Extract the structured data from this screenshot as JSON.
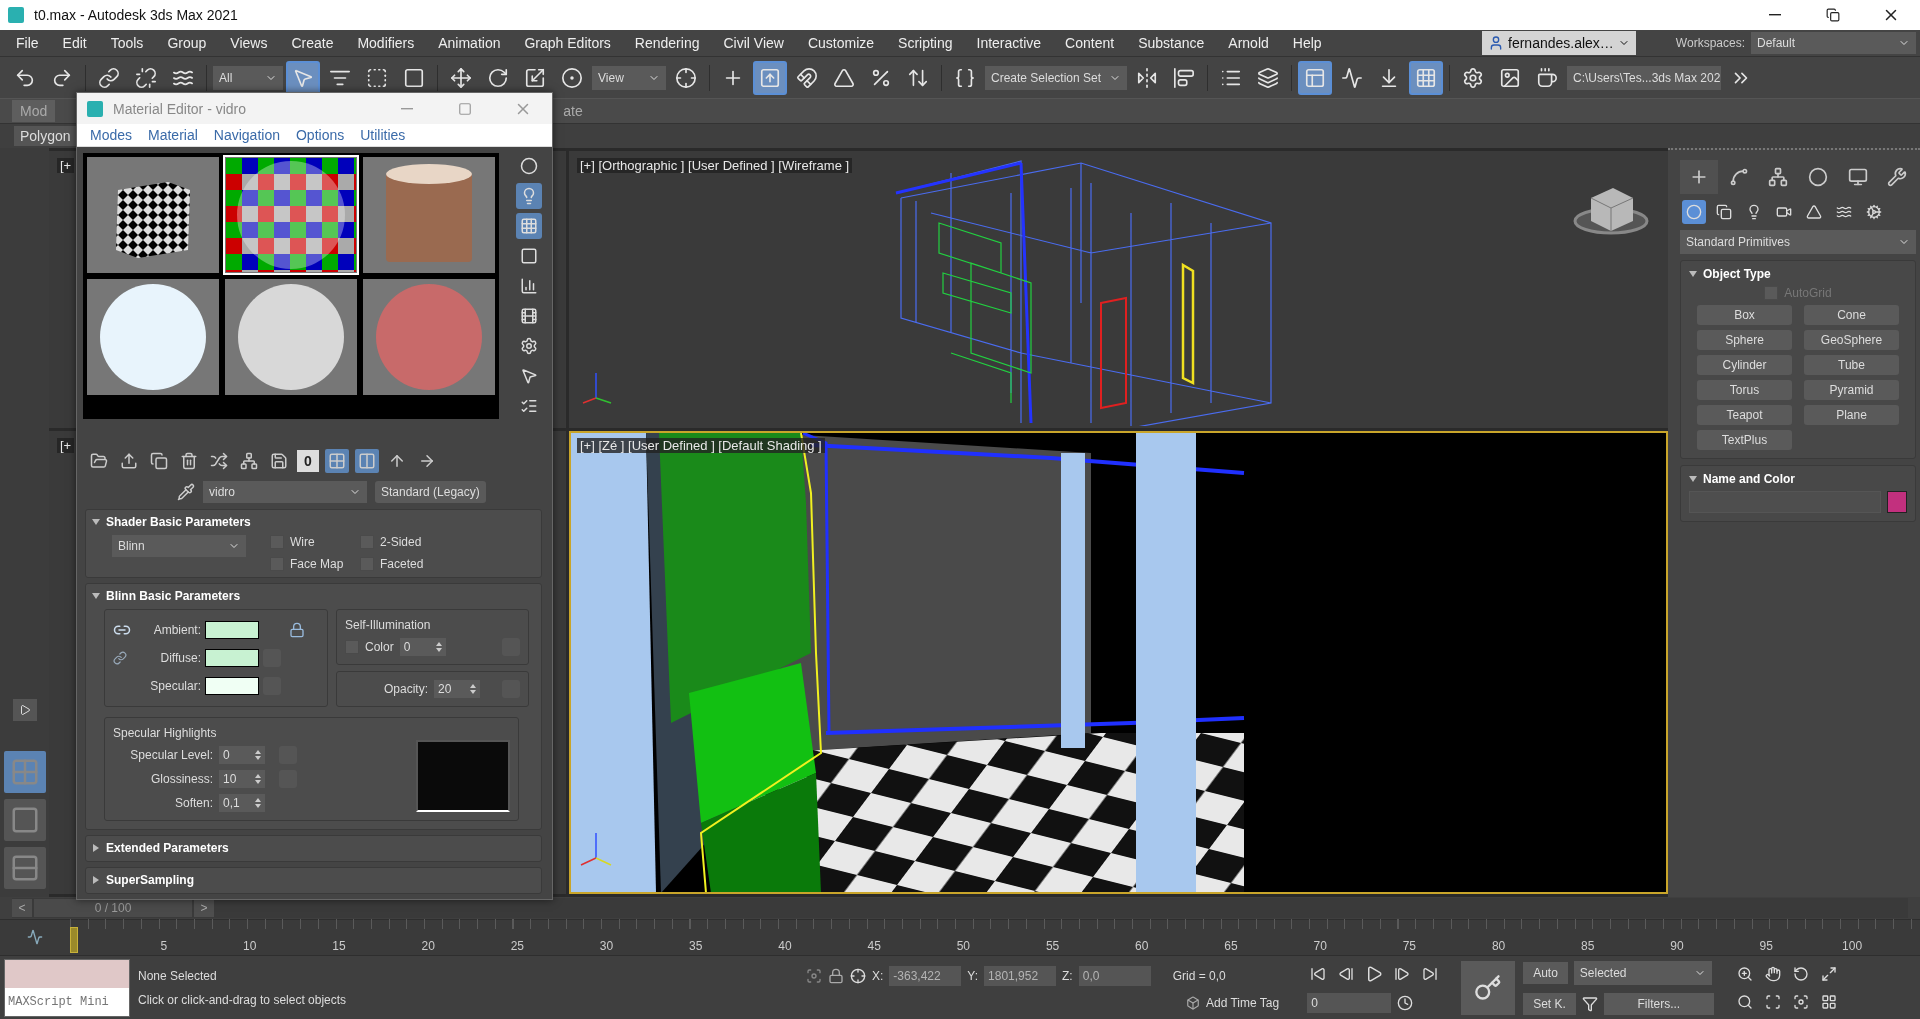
{
  "window": {
    "title": "t0.max - Autodesk 3ds Max 2021"
  },
  "menu": [
    "File",
    "Edit",
    "Tools",
    "Group",
    "Views",
    "Create",
    "Modifiers",
    "Animation",
    "Graph Editors",
    "Rendering",
    "Civil View",
    "Customize",
    "Scripting",
    "Interactive",
    "Content",
    "Substance",
    "Arnold",
    "Help"
  ],
  "account": {
    "name": "fernandes.alex…"
  },
  "workspaces": {
    "label": "Workspaces:",
    "value": "Default"
  },
  "toolbar": [
    {
      "kind": "tool",
      "selected": false
    },
    {
      "kind": "tool",
      "selected": false
    },
    {
      "kind": "tool",
      "selected": false
    },
    {
      "kind": "tool",
      "selected": false
    },
    {
      "kind": "tool",
      "selected": false
    },
    {
      "kind": "dropdown",
      "value": "All"
    },
    {
      "kind": "tool",
      "selected": true
    },
    {
      "kind": "tool",
      "selected": false
    },
    {
      "kind": "tool",
      "selected": false
    },
    {
      "kind": "tool",
      "selected": false
    },
    {
      "kind": "tool",
      "selected": false
    },
    {
      "kind": "tool",
      "selected": false
    },
    {
      "kind": "tool",
      "selected": false
    },
    {
      "kind": "tool",
      "selected": false
    },
    {
      "kind": "dropdown",
      "value": "View"
    },
    {
      "kind": "tool",
      "selected": false
    },
    {
      "kind": "tool",
      "selected": false
    },
    {
      "kind": "tool",
      "selected": true
    },
    {
      "kind": "tool",
      "selected": false
    },
    {
      "kind": "tool",
      "selected": false
    },
    {
      "kind": "tool",
      "selected": false
    },
    {
      "kind": "tool",
      "selected": false
    },
    {
      "kind": "tool",
      "selected": false
    },
    {
      "kind": "dropdown",
      "value": "Create Selection Set"
    },
    {
      "kind": "tool",
      "selected": false
    },
    {
      "kind": "tool",
      "selected": false
    },
    {
      "kind": "tool",
      "selected": false
    },
    {
      "kind": "tool",
      "selected": false
    },
    {
      "kind": "tool",
      "selected": true
    },
    {
      "kind": "tool",
      "selected": false
    },
    {
      "kind": "tool",
      "selected": false
    },
    {
      "kind": "tool",
      "selected": true
    },
    {
      "kind": "tool",
      "selected": false
    },
    {
      "kind": "tool",
      "selected": false
    },
    {
      "kind": "tool",
      "selected": false
    },
    {
      "kind": "dropdown",
      "value": "C:\\Users\\Tes...3ds Max 202"
    },
    {
      "kind": "tool",
      "selected": false
    }
  ],
  "ribbon": {
    "tabs": [
      {
        "label": "Mod",
        "selected": true
      },
      {
        "label": "ate",
        "selected": false
      }
    ],
    "panel": "Polygon"
  },
  "layout_tabs": [
    {
      "selected": true
    },
    {
      "selected": false
    },
    {
      "selected": false
    }
  ],
  "viewports": [
    {
      "label": "[+",
      "kind": "hidden",
      "active": false
    },
    {
      "label": "[+] [Orthographic ] [User Defined ] [Wireframe ]",
      "kind": "wireframe",
      "active": false
    },
    {
      "label": "[+",
      "kind": "hidden",
      "active": false
    },
    {
      "label": "[+] [Zé ] [User Defined ] [Default Shading ]",
      "kind": "shaded",
      "active": true
    }
  ],
  "material_editor": {
    "title": "Material Editor - vidro",
    "menu": [
      "Modes",
      "Material",
      "Navigation",
      "Options",
      "Utilities"
    ],
    "slots": [
      {
        "kind": "cube",
        "selected": false
      },
      {
        "kind": "checker",
        "selected": true
      },
      {
        "kind": "photo",
        "selected": false
      },
      {
        "kind": "sphere",
        "selected": false,
        "color": "#e8f4fc"
      },
      {
        "kind": "sphere",
        "selected": false,
        "color": "#d8d8d8"
      },
      {
        "kind": "sphere",
        "selected": false,
        "color": "#c86a6a"
      }
    ],
    "side_tools": [
      {
        "selected": false
      },
      {
        "selected": true
      },
      {
        "selected": true
      },
      {
        "selected": false
      },
      {
        "selected": false
      },
      {
        "selected": false
      },
      {
        "selected": false
      },
      {
        "selected": false
      },
      {
        "selected": false
      }
    ],
    "tools": [
      {
        "kind": "tool",
        "selected": false
      },
      {
        "kind": "tool",
        "selected": false
      },
      {
        "kind": "tool",
        "selected": false
      },
      {
        "kind": "tool",
        "selected": false
      },
      {
        "kind": "tool",
        "selected": false
      },
      {
        "kind": "tool",
        "selected": false
      },
      {
        "kind": "tool",
        "selected": false
      },
      {
        "kind": "text",
        "label": "0",
        "selected": false
      },
      {
        "kind": "tool",
        "selected": true
      },
      {
        "kind": "tool",
        "selected": true
      },
      {
        "kind": "tool",
        "selected": false
      },
      {
        "kind": "tool",
        "selected": false
      }
    ],
    "material_name": "vidro",
    "material_type": "Standard (Legacy)",
    "shader": {
      "title": "Shader Basic Parameters",
      "expanded": true,
      "value": "Blinn",
      "options": [
        {
          "label": "Wire",
          "checked": false
        },
        {
          "label": "2-Sided",
          "checked": false
        },
        {
          "label": "Face Map",
          "checked": false
        },
        {
          "label": "Faceted",
          "checked": false
        }
      ]
    },
    "basic": {
      "title": "Blinn Basic Parameters",
      "expanded": true,
      "colors": [
        {
          "label": "Ambient:",
          "color": "#c8f2d2"
        },
        {
          "label": "Diffuse:",
          "color": "#c8f2d2"
        },
        {
          "label": "Specular:",
          "color": "#f0fff4"
        }
      ],
      "self_illumination": {
        "title": "Self-Illumination",
        "label": "Color",
        "checked": false,
        "value": "0"
      },
      "opacity": {
        "label": "Opacity:",
        "value": "20"
      },
      "highlights": {
        "title": "Specular Highlights",
        "fields": [
          {
            "label": "Specular Level:",
            "value": "0"
          },
          {
            "label": "Glossiness:",
            "value": "10"
          },
          {
            "label": "Soften:",
            "value": "0,1"
          }
        ]
      }
    },
    "collapsed": [
      {
        "title": "Extended Parameters",
        "expanded": false
      },
      {
        "title": "SuperSampling",
        "expanded": false
      }
    ]
  },
  "command_panel": {
    "tabs": [
      {
        "selected": true
      },
      {
        "selected": false
      },
      {
        "selected": false
      },
      {
        "selected": false
      },
      {
        "selected": false
      },
      {
        "selected": false
      }
    ],
    "categories": [
      {
        "selected": true
      },
      {
        "selected": false
      },
      {
        "selected": false
      },
      {
        "selected": false
      },
      {
        "selected": false
      },
      {
        "selected": false
      },
      {
        "selected": false
      }
    ],
    "dropdown": "Standard Primitives",
    "object_type": {
      "title": "Object Type",
      "expanded": true,
      "autogrid": {
        "label": "AutoGrid",
        "checked": false,
        "disabled": true
      },
      "buttons": [
        "Box",
        "Cone",
        "Sphere",
        "GeoSphere",
        "Cylinder",
        "Tube",
        "Torus",
        "Pyramid",
        "Teapot",
        "Plane",
        "TextPlus"
      ]
    },
    "name_color": {
      "title": "Name and Color",
      "expanded": true,
      "color": "#c2307e"
    }
  },
  "time_slider": {
    "value": "0 / 100",
    "prev": "<",
    "next": ">"
  },
  "track_ticks": [
    "5",
    "10",
    "15",
    "20",
    "25",
    "30",
    "35",
    "40",
    "45",
    "50",
    "55",
    "60",
    "65",
    "70",
    "75",
    "80",
    "85",
    "90",
    "95",
    "100"
  ],
  "status": {
    "script": {
      "placeholder": "MAXScript Mini"
    },
    "selection": "None Selected",
    "prompt": "Click or click-and-drag to select objects",
    "x": {
      "label": "X:",
      "value": "-363,422"
    },
    "y": {
      "label": "Y:",
      "value": "1801,952"
    },
    "z": {
      "label": "Z:",
      "value": "0,0"
    },
    "grid": "Grid = 0,0",
    "time_tag": "Add Time Tag",
    "frame": "0",
    "auto_key": "Auto",
    "key_mode": "Selected",
    "set_key": "Set K.",
    "filters": "Filters..."
  }
}
